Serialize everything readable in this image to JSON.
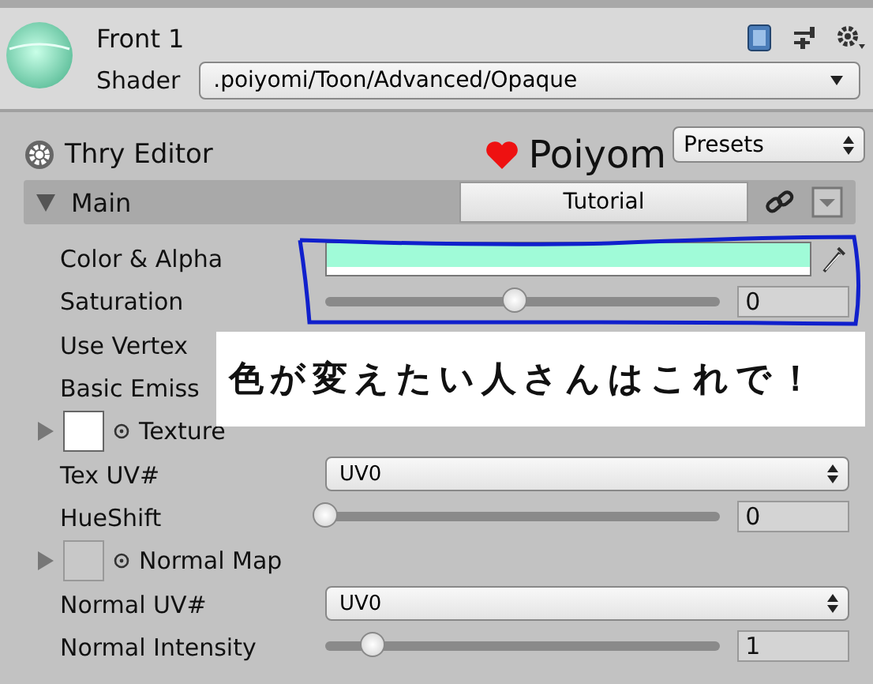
{
  "material": {
    "name": "Front 1",
    "shader_label": "Shader",
    "shader": ".poiyomi/Toon/Advanced/Opaque"
  },
  "editor": {
    "title": "Thry Editor",
    "brand": "Poiyom",
    "presets": "Presets"
  },
  "section": {
    "title": "Main",
    "expanded": true,
    "tutorial": "Tutorial"
  },
  "properties": [
    {
      "kind": "color",
      "label": "Color & Alpha",
      "color": "#a0fbd8"
    },
    {
      "kind": "slider",
      "label": "Saturation",
      "level": 0.48,
      "value": "0"
    },
    {
      "kind": "label",
      "label": "Use Vertex"
    },
    {
      "kind": "label",
      "label": "Basic Emiss"
    },
    {
      "kind": "texture",
      "label": "Texture",
      "filled": true
    },
    {
      "kind": "dropdown",
      "label": "Tex UV#",
      "value": "UV0"
    },
    {
      "kind": "slider",
      "label": "HueShift",
      "level": 0,
      "value": "0"
    },
    {
      "kind": "texture",
      "label": "Normal Map",
      "filled": false
    },
    {
      "kind": "dropdown",
      "label": "Normal UV#",
      "value": "UV0"
    },
    {
      "kind": "slider",
      "label": "Normal Intensity",
      "level": 0.12,
      "value": "1"
    }
  ],
  "annotation": {
    "text": "色が変えたい人さんはこれで！"
  }
}
